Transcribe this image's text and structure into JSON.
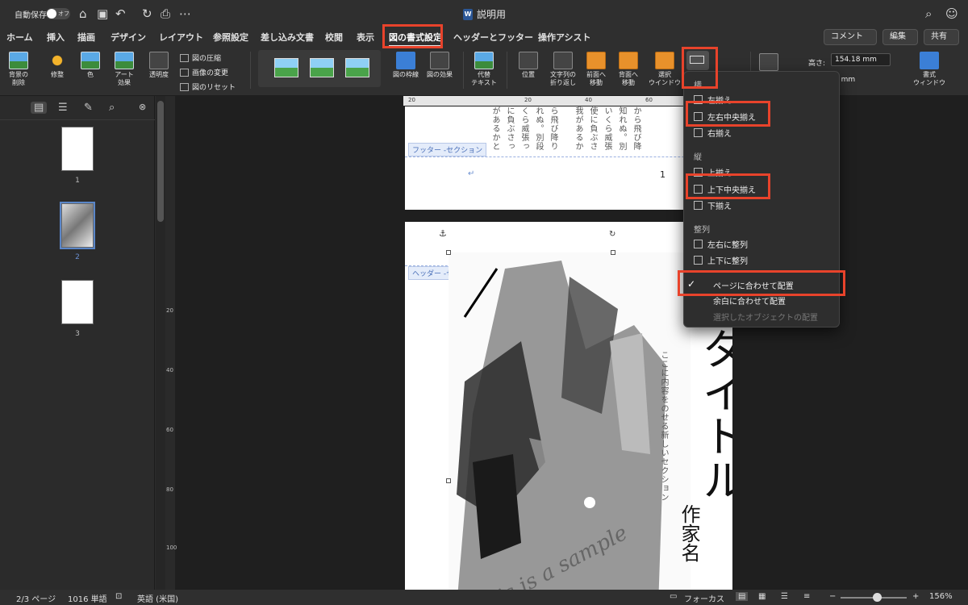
{
  "titlebar": {
    "autosave": "自動保存",
    "toggle": "オフ",
    "doc_title": "説明用"
  },
  "tabs": [
    "ホーム",
    "挿入",
    "描画",
    "デザイン",
    "レイアウト",
    "参照設定",
    "差し込み文書",
    "校閲",
    "表示",
    "図の書式設定",
    "ヘッダーとフッター",
    "操作アシスト"
  ],
  "tab_active": "図の書式設定",
  "top_buttons": {
    "comment": "コメント",
    "edit": "編集",
    "share": "共有"
  },
  "ribbon": {
    "remove_bg": "背景の\n削除",
    "corrections": "修整",
    "color": "色",
    "art": "アート\n効果",
    "transparency": "透明度",
    "compress": "図の圧縮",
    "change": "画像の変更",
    "reset": "図のリセット",
    "border": "図の枠線",
    "effects": "図の効果",
    "alt_text": "代替\nテキスト",
    "position": "位置",
    "wrap": "文字列の\n折り返し",
    "forward": "前面へ\n移動",
    "backward": "背面へ\n移動",
    "selection": "選択\nウインドウ",
    "height_label": "高さ:",
    "height_value": "154.18 mm",
    "width_value": "1 mm",
    "format_pane": "書式\nウィンドウ"
  },
  "ruler": [
    "20",
    "20",
    "40",
    "60",
    "80",
    "100"
  ],
  "ruler_v": [
    "20",
    "40",
    "60",
    "80",
    "100"
  ],
  "thumbnails": [
    "1",
    "2",
    "3"
  ],
  "page1": {
    "columns": [
      "から飛び降",
      "知れぬ。別",
      "いくら威張",
      "ら飛び降り",
      "れぬ。別段",
      "くら威張っ",
      "に負ぶさっ",
      "があるかと",
      "使に負ぶさ",
      "我があるか"
    ],
    "page_num": "1",
    "footer_tag": "フッター -セクション",
    "cr_mark": "↵"
  },
  "page2": {
    "header_tag": "ヘッダー -セクション",
    "big_title": "タイトル",
    "author": "作家名",
    "tagline": "ここに内容をのせる新しいセクション",
    "sample": "This is a sample"
  },
  "menu": {
    "horizontal": "横",
    "left": "左揃え",
    "center_h": "左右中央揃え",
    "right": "右揃え",
    "vertical": "縦",
    "top": "上揃え",
    "center_v": "上下中央揃え",
    "bottom": "下揃え",
    "distribute": "整列",
    "dist_h": "左右に整列",
    "dist_v": "上下に整列",
    "page": "ページに合わせて配置",
    "margin": "余白に合わせて配置",
    "selected": "選択したオブジェクトの配置",
    "check": "✓"
  },
  "status": {
    "page": "2/3 ページ",
    "words": "1016 単語",
    "lang": "英語 (米国)",
    "focus": "フォーカス",
    "zoom": "156%"
  }
}
